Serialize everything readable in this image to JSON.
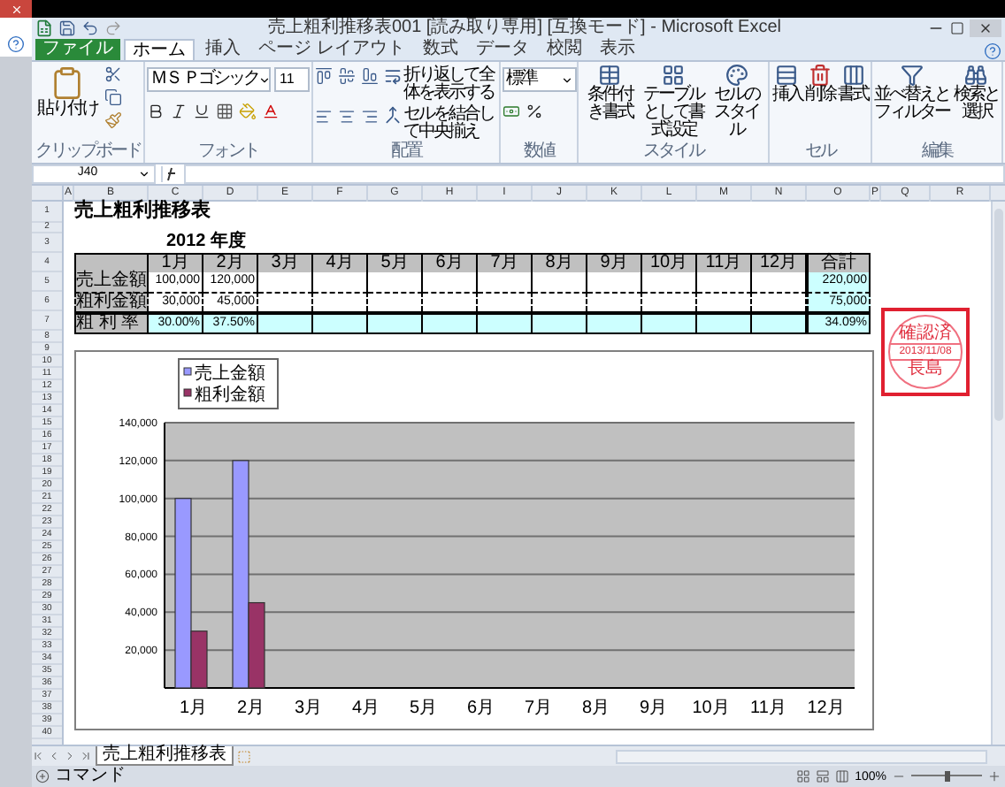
{
  "window": {
    "title": "売上粗利推移表001 [読み取り専用] [互換モード] - Microsoft Excel"
  },
  "ribbon_tabs": [
    {
      "label": "ファイル",
      "kind": "file",
      "selected": false
    },
    {
      "label": "ホーム",
      "kind": "tab",
      "selected": true
    },
    {
      "label": "挿入",
      "kind": "tab",
      "selected": false
    },
    {
      "label": "ページ レイアウト",
      "kind": "tab",
      "selected": false
    },
    {
      "label": "数式",
      "kind": "tab",
      "selected": false
    },
    {
      "label": "データ",
      "kind": "tab",
      "selected": false
    },
    {
      "label": "校閲",
      "kind": "tab",
      "selected": false
    },
    {
      "label": "表示",
      "kind": "tab",
      "selected": false
    }
  ],
  "ribbon_groups": [
    {
      "label": "クリップボード",
      "kind": "clipboard",
      "buttons": [
        "貼り付け"
      ]
    },
    {
      "label": "フォント",
      "kind": "font",
      "font_name": "ＭＳ Ｐゴシック",
      "font_size": "11"
    },
    {
      "label": "配置",
      "kind": "alignment",
      "buttons": [
        "折り返して全体を表示する",
        "セルを結合して中央揃え"
      ]
    },
    {
      "label": "数値",
      "kind": "number",
      "format": "標準"
    },
    {
      "label": "スタイル",
      "kind": "style",
      "buttons": [
        "条件付き書式",
        "テーブルとして書式設定",
        "セルのスタイル"
      ]
    },
    {
      "label": "セル",
      "kind": "cells",
      "buttons": [
        "挿入",
        "削除",
        "書式"
      ]
    },
    {
      "label": "編集",
      "kind": "edit",
      "buttons": [
        "並べ替えとフィルター",
        "検索と選択"
      ]
    }
  ],
  "formula_bar": {
    "name_box": "J40"
  },
  "sheet": {
    "columns": [
      "A",
      "B",
      "C",
      "D",
      "E",
      "F",
      "G",
      "H",
      "I",
      "J",
      "K",
      "L",
      "M",
      "N",
      "O",
      "P",
      "Q",
      "R"
    ],
    "row_numbers": [
      "1",
      "2",
      "3",
      "4",
      "5",
      "6",
      "7",
      "8",
      "9",
      "10",
      "11",
      "12",
      "13",
      "14",
      "15",
      "16",
      "17",
      "18",
      "19",
      "20",
      "21",
      "22",
      "23",
      "24",
      "25",
      "26",
      "27",
      "28",
      "29",
      "30",
      "31",
      "32",
      "33",
      "34",
      "35",
      "36",
      "37",
      "38",
      "39",
      "40"
    ],
    "title": "売上粗利推移表",
    "fiscal_year": "2012 年度",
    "table": {
      "header": [
        "1月",
        "2月",
        "3月",
        "4月",
        "5月",
        "6月",
        "7月",
        "8月",
        "9月",
        "10月",
        "11月",
        "12月"
      ],
      "total_header": "合計",
      "rows": [
        {
          "label": "売上金額",
          "kind": "amount",
          "values": [
            "100,000",
            "120,000"
          ],
          "total": "220,000"
        },
        {
          "label": "粗利金額",
          "kind": "amount",
          "values": [
            "30,000",
            "45,000"
          ],
          "total": "75,000"
        },
        {
          "label": "粗 利 率",
          "kind": "rate",
          "values": [
            "30.00%",
            "37.50%"
          ],
          "total": "34.09%"
        }
      ]
    },
    "chart": {
      "chart_data": {
        "type": "bar",
        "categories": [
          "1月",
          "2月",
          "3月",
          "4月",
          "5月",
          "6月",
          "7月",
          "8月",
          "9月",
          "10月",
          "11月",
          "12月"
        ],
        "series": [
          {
            "name": "売上金額",
            "color": "#9999ff",
            "values": [
              100000,
              120000,
              null,
              null,
              null,
              null,
              null,
              null,
              null,
              null,
              null,
              null
            ]
          },
          {
            "name": "粗利金額",
            "color": "#993366",
            "values": [
              30000,
              45000,
              null,
              null,
              null,
              null,
              null,
              null,
              null,
              null,
              null,
              null
            ]
          }
        ],
        "ylim": [
          0,
          140000
        ],
        "grid": true,
        "legend": true,
        "yticks": [
          {
            "value": 20000,
            "label": "20,000"
          },
          {
            "value": 40000,
            "label": "40,000"
          },
          {
            "value": 60000,
            "label": "60,000"
          },
          {
            "value": 80000,
            "label": "80,000"
          },
          {
            "value": 100000,
            "label": "100,000"
          },
          {
            "value": 120000,
            "label": "120,000"
          },
          {
            "value": 140000,
            "label": "140,000"
          }
        ]
      }
    },
    "stamp": {
      "lines": [
        "確認済",
        "2013/11/08",
        "長島"
      ]
    }
  },
  "sheet_tabs": [
    {
      "label": "売上粗利推移表",
      "selected": true
    }
  ],
  "status_bar": {
    "mode": "コマンド",
    "zoom": "100%",
    "zoom_slider": {
      "level": 0.5
    }
  }
}
